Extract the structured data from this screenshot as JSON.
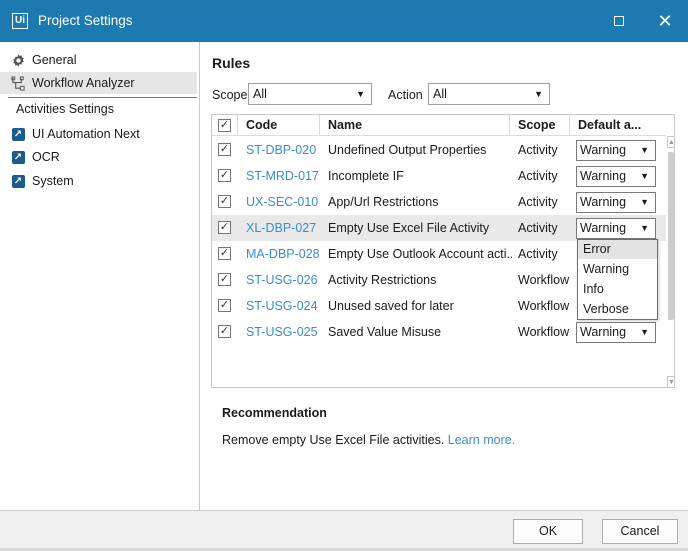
{
  "window": {
    "app_icon": "Ui",
    "title": "Project Settings",
    "maximize_icon": "maximize-icon",
    "close_icon": "close-icon",
    "accent": "#1c7ab0"
  },
  "sidebar": {
    "items": [
      {
        "label": "General",
        "icon": "gear-icon",
        "selected": false
      },
      {
        "label": "Workflow Analyzer",
        "icon": "workflow-analyzer-icon",
        "selected": true
      }
    ],
    "section_label": "Activities Settings",
    "activity_items": [
      {
        "label": "UI Automation Next",
        "icon": "activity-package-icon"
      },
      {
        "label": "OCR",
        "icon": "activity-package-icon"
      },
      {
        "label": "System",
        "icon": "activity-package-icon"
      }
    ]
  },
  "rules": {
    "title": "Rules",
    "scope_label": "Scope",
    "scope_value": "All",
    "action_label": "Action",
    "action_value": "All",
    "columns": [
      "Code",
      "Name",
      "Scope",
      "Default a..."
    ],
    "rows": [
      {
        "checked": true,
        "code": "ST-DBP-020",
        "name": "Undefined Output Properties",
        "scope": "Activity",
        "action": "Warning"
      },
      {
        "checked": true,
        "code": "ST-MRD-017",
        "name": "Incomplete IF",
        "scope": "Activity",
        "action": "Warning"
      },
      {
        "checked": true,
        "code": "UX-SEC-010",
        "name": "App/Url Restrictions",
        "scope": "Activity",
        "action": "Warning"
      },
      {
        "checked": true,
        "code": "XL-DBP-027",
        "name": "Empty Use Excel File Activity",
        "scope": "Activity",
        "action": "Warning",
        "highlighted": true
      },
      {
        "checked": true,
        "code": "MA-DBP-028",
        "name": "Empty Use Outlook Account acti...",
        "scope": "Activity",
        "action": ""
      },
      {
        "checked": true,
        "code": "ST-USG-026",
        "name": "Activity Restrictions",
        "scope": "Workflow",
        "action": ""
      },
      {
        "checked": true,
        "code": "ST-USG-024",
        "name": "Unused saved for later",
        "scope": "Workflow",
        "action": ""
      },
      {
        "checked": true,
        "code": "ST-USG-025",
        "name": "Saved Value Misuse",
        "scope": "Workflow",
        "action": "Warning"
      }
    ],
    "dropdown_options": [
      "Error",
      "Warning",
      "Info",
      "Verbose"
    ],
    "dropdown_active_index": 0
  },
  "recommendation": {
    "title": "Recommendation",
    "text": "Remove empty Use Excel File activities.",
    "link": "Learn more."
  },
  "footer": {
    "ok_label": "OK",
    "cancel_label": "Cancel"
  }
}
